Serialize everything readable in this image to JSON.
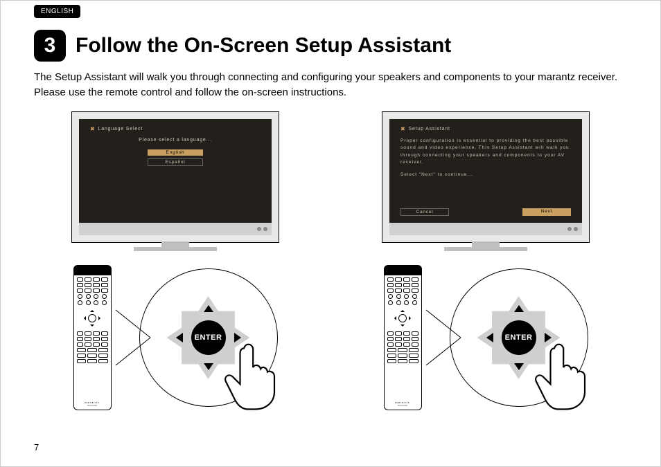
{
  "language_tag": "ENGLISH",
  "step_number": "3",
  "heading": "Follow the On-Screen Setup Assistant",
  "body": "The Setup Assistant will walk you through connecting and configuring your speakers and components to your marantz receiver. Please use the remote control and follow the on-screen instructions.",
  "page_number": "7",
  "enter_label": "ENTER",
  "remote_brand": "marantz",
  "remote_model": "RC015SR",
  "tv_left": {
    "title": "Language Select",
    "prompt": "Please select a language...",
    "options": [
      "English",
      "Español"
    ],
    "selected_index": 0
  },
  "tv_right": {
    "title": "Setup Assistant",
    "paragraph": "Proper configuration is essential to providing the best possible sound and video experience. This Setup Assistant will walk you through connecting your speakers and components to your AV receiver.",
    "cta": "Select \"Next\" to continue...",
    "buttons": [
      "Cancel",
      "Next"
    ],
    "selected_button": 1
  }
}
